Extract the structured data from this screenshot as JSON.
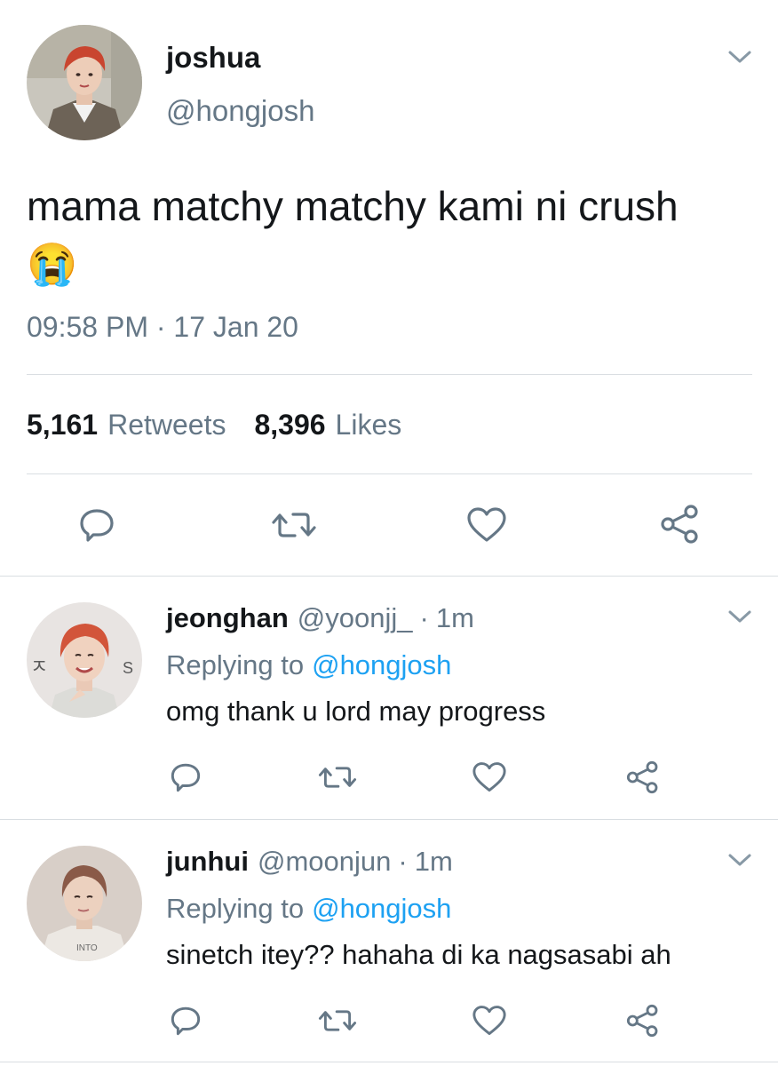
{
  "main_tweet": {
    "display_name": "joshua",
    "handle": "@hongjosh",
    "text": "mama matchy matchy kami ni crush",
    "emoji": "😭",
    "timestamp": "09:58 PM · 17 Jan 20",
    "retweets_count": "5,161",
    "retweets_label": "Retweets",
    "likes_count": "8,396",
    "likes_label": "Likes"
  },
  "replies": [
    {
      "display_name": "jeonghan",
      "handle": "@yoonjj_",
      "separator": "·",
      "time": "1m",
      "replying_prefix": "Replying to",
      "replying_handle": "@hongjosh",
      "text": "omg thank u lord may progress"
    },
    {
      "display_name": "junhui",
      "handle": "@moonjun",
      "separator": "·",
      "time": "1m",
      "replying_prefix": "Replying to",
      "replying_handle": "@hongjosh",
      "text": "sinetch itey?? hahaha di ka nagsasabi ah"
    }
  ],
  "colors": {
    "text": "#14171a",
    "muted": "#657786",
    "link": "#1da1f2",
    "divider": "#d9dee2"
  },
  "icons": [
    "chevron-down-icon",
    "reply-icon",
    "retweet-icon",
    "like-icon",
    "share-icon"
  ]
}
